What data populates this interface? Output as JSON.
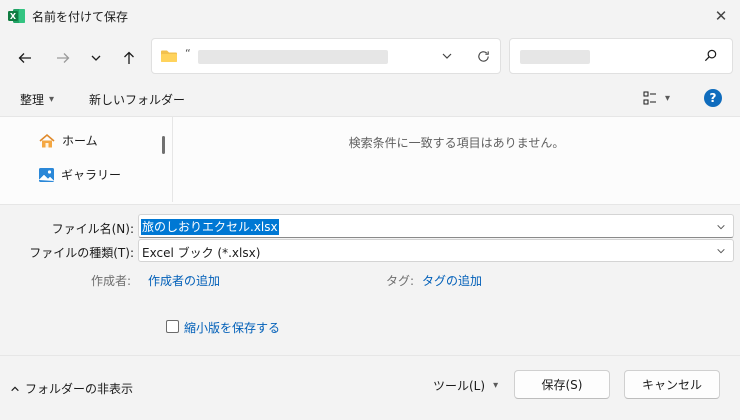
{
  "window": {
    "title": "名前を付けて保存",
    "app_icon_letter": "X",
    "close_glyph": "✕"
  },
  "nav": {
    "address_quote": "“",
    "search_placeholder": ""
  },
  "toolbar": {
    "organize_label": "整理",
    "new_folder_label": "新しいフォルダー"
  },
  "sidebar": {
    "items": [
      {
        "label": "ホーム",
        "icon": "home-icon"
      },
      {
        "label": "ギャラリー",
        "icon": "gallery-icon"
      }
    ]
  },
  "content": {
    "empty_message": "検索条件に一致する項目はありません。"
  },
  "form": {
    "filename_label": "ファイル名(N):",
    "filename_value": "旅のしおりエクセル.xlsx",
    "filetype_label": "ファイルの種類(T):",
    "filetype_value": "Excel ブック (*.xlsx)",
    "author_label": "作成者:",
    "author_link": "作成者の追加",
    "tags_label": "タグ:",
    "tags_link": "タグの追加",
    "thumbnail_label": "縮小版を保存する",
    "thumbnail_checked": false
  },
  "footer": {
    "hide_folders_label": "フォルダーの非表示",
    "tools_label": "ツール(L)",
    "save_label": "保存(S)",
    "cancel_label": "キャンセル"
  },
  "colors": {
    "accent": "#0078d4",
    "link": "#005fb8",
    "excel_green": "#107c41",
    "help_blue": "#0f6cbd"
  }
}
